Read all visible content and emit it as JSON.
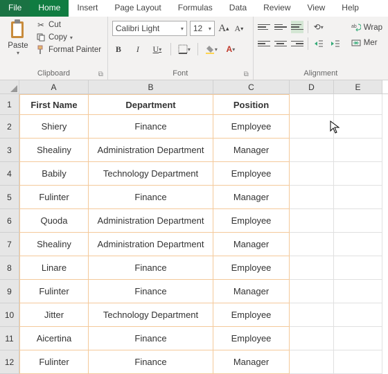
{
  "menu": {
    "file": "File",
    "home": "Home",
    "insert": "Insert",
    "pageLayout": "Page Layout",
    "formulas": "Formulas",
    "data": "Data",
    "review": "Review",
    "view": "View",
    "help": "Help"
  },
  "ribbon": {
    "clipboard": {
      "paste": "Paste",
      "cut": "Cut",
      "copy": "Copy",
      "formatPainter": "Format Painter",
      "label": "Clipboard"
    },
    "font": {
      "name": "Calibri Light",
      "size": "12",
      "label": "Font"
    },
    "alignment": {
      "wrap": "Wrap",
      "merge": "Mer",
      "label": "Alignment"
    }
  },
  "columns": {
    "a": "A",
    "b": "B",
    "c": "C",
    "d": "D",
    "e": "E"
  },
  "rowNums": [
    "1",
    "2",
    "3",
    "4",
    "5",
    "6",
    "7",
    "8",
    "9",
    "10",
    "11",
    "12"
  ],
  "table": {
    "headers": {
      "a": "First Name",
      "b": "Department",
      "c": "Position"
    },
    "rows": [
      {
        "a": "Shiery",
        "b": "Finance",
        "c": "Employee"
      },
      {
        "a": "Shealiny",
        "b": "Administration Department",
        "c": "Manager"
      },
      {
        "a": "Babily",
        "b": "Technology Department",
        "c": "Employee"
      },
      {
        "a": "Fulinter",
        "b": "Finance",
        "c": "Manager"
      },
      {
        "a": "Quoda",
        "b": "Administration Department",
        "c": "Employee"
      },
      {
        "a": "Shealiny",
        "b": "Administration Department",
        "c": "Manager"
      },
      {
        "a": "Linare",
        "b": "Finance",
        "c": "Employee"
      },
      {
        "a": "Fulinter",
        "b": "Finance",
        "c": "Manager"
      },
      {
        "a": "Jitter",
        "b": "Technology Department",
        "c": "Employee"
      },
      {
        "a": "Aicertina",
        "b": "Finance",
        "c": "Employee"
      },
      {
        "a": "Fulinter",
        "b": "Finance",
        "c": "Manager"
      }
    ]
  }
}
